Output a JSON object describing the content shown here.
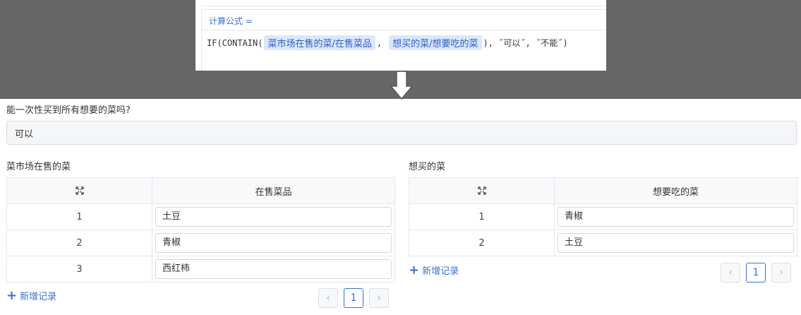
{
  "formula": {
    "label": "计算公式 =",
    "prefix": "IF(CONTAIN(",
    "chip1": "菜市场在售的菜/在售菜品",
    "sep": ",",
    "chip2": "想买的菜/想要吃的菜",
    "suffix": "), ˝可以˝, ˝不能˝)"
  },
  "question": {
    "label": "能一次性买到所有想要的菜吗?",
    "answer": "可以"
  },
  "left_table": {
    "title": "菜市场在售的菜",
    "column": "在售菜品",
    "rows": [
      {
        "index": "1",
        "value": "土豆"
      },
      {
        "index": "2",
        "value": "青椒"
      },
      {
        "index": "3",
        "value": "西红柿"
      }
    ],
    "add_label": "新增记录",
    "page": "1"
  },
  "right_table": {
    "title": "想买的菜",
    "column": "想要吃的菜",
    "rows": [
      {
        "index": "1",
        "value": "青椒"
      },
      {
        "index": "2",
        "value": "土豆"
      }
    ],
    "add_label": "新增记录",
    "page": "1"
  },
  "icons": {
    "expand": "expand-arrows-icon",
    "arrow": "down-arrow-icon",
    "prev": "chevron-left-icon",
    "next": "chevron-right-icon",
    "add": "plus-icon"
  },
  "colors": {
    "accent": "#3a6fd6",
    "chip_bg": "#dbe7fb",
    "dark_band": "#666666"
  }
}
